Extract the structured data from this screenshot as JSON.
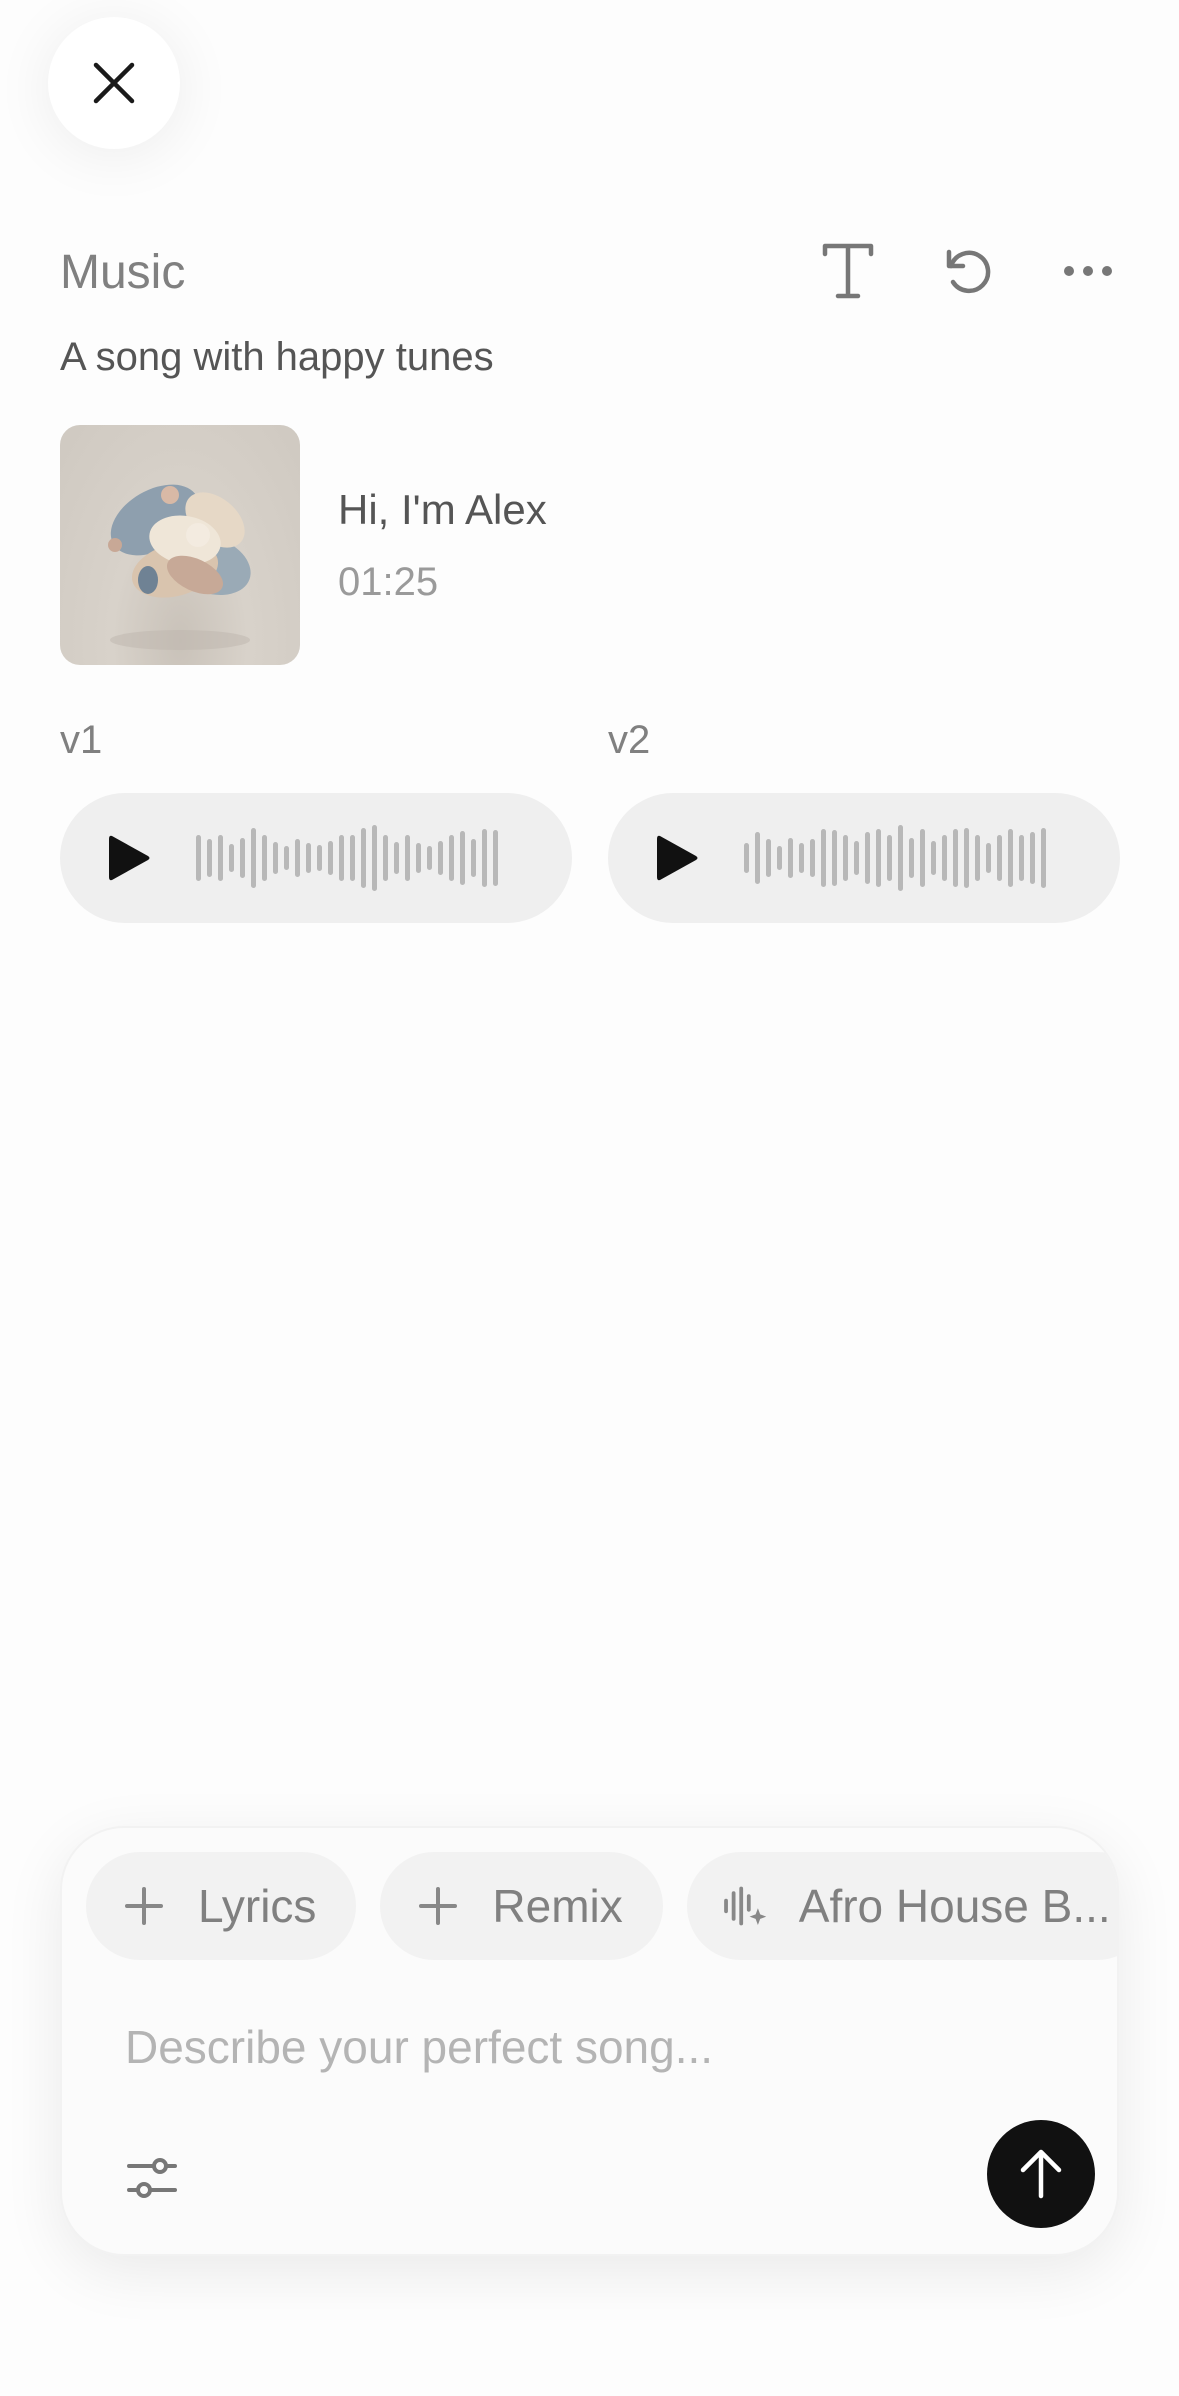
{
  "header": {
    "close_icon": "close-icon",
    "section_title": "Music",
    "actions": [
      {
        "name": "lyrics-text-icon"
      },
      {
        "name": "regenerate-icon"
      },
      {
        "name": "more-options-icon"
      }
    ]
  },
  "prompt": "A song with happy tunes",
  "track": {
    "title": "Hi, I'm Alex",
    "duration": "01:25"
  },
  "versions": [
    {
      "label": "v1"
    },
    {
      "label": "v2"
    }
  ],
  "composer": {
    "chips": [
      {
        "icon": "plus-icon",
        "label": "Lyrics"
      },
      {
        "icon": "plus-icon",
        "label": "Remix"
      },
      {
        "icon": "waveform-sparkle-icon",
        "label": "Afro House B..."
      }
    ],
    "placeholder": "Describe your perfect song...",
    "settings_icon": "sliders-icon",
    "send_icon": "arrow-up-icon"
  },
  "colors": {
    "background": "#fdfdfd",
    "player_bg": "#efefef",
    "send_button": "#111111",
    "muted_text": "#808080"
  }
}
